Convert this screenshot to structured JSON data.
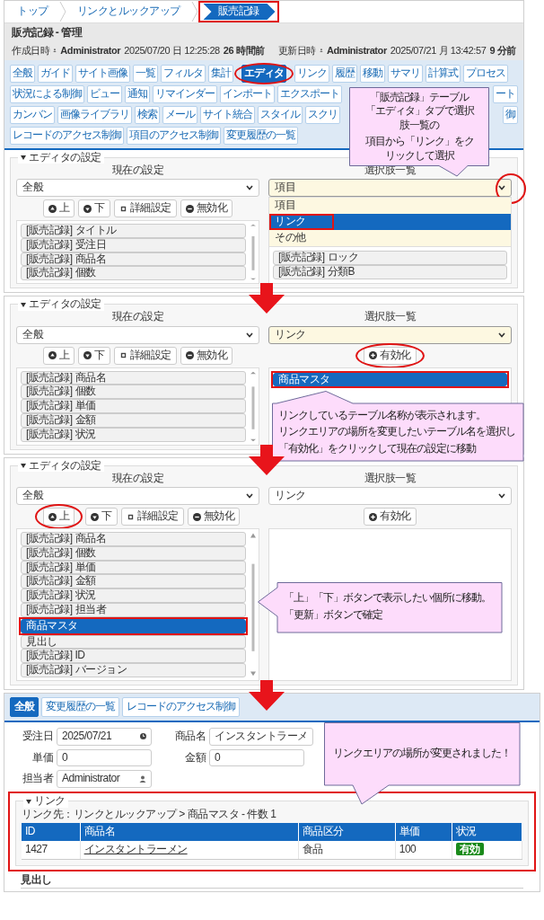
{
  "breadcrumb": [
    {
      "label": "トップ",
      "selected": false,
      "boxed": false
    },
    {
      "label": "リンクとルックアップ",
      "selected": false,
      "boxed": false
    },
    {
      "label": "販売記録",
      "selected": true,
      "boxed": true
    }
  ],
  "title": "販売記録 - 管理",
  "meta": {
    "created_label": "作成日時",
    "created_by": "Administrator",
    "created_at": "2025/07/20 日 12:25:28",
    "created_ago": "26 時間前",
    "updated_label": "更新日時",
    "updated_by": "Administrator",
    "updated_at": "2025/07/21 月 13:42:57",
    "updated_ago": "9 分前"
  },
  "tab_rows": [
    [
      {
        "label": "全般",
        "selected": false,
        "circled": false,
        "kind": "normal"
      },
      {
        "label": "ガイド",
        "selected": false,
        "circled": false,
        "kind": "normal"
      },
      {
        "label": "サイト画像",
        "selected": false,
        "circled": false,
        "kind": "normal"
      },
      {
        "label": "一覧",
        "selected": false,
        "circled": false,
        "kind": "normal"
      },
      {
        "label": "フィルタ",
        "selected": false,
        "circled": false,
        "kind": "normal"
      },
      {
        "label": "集計",
        "selected": false,
        "circled": false,
        "kind": "normal"
      },
      {
        "label": "エディタ",
        "selected": true,
        "circled": true,
        "kind": "normal"
      },
      {
        "label": "リンク",
        "selected": false,
        "circled": false,
        "kind": "normal"
      },
      {
        "label": "履歴",
        "selected": false,
        "circled": false,
        "kind": "normal"
      },
      {
        "label": "移動",
        "selected": false,
        "circled": false,
        "kind": "normal"
      },
      {
        "label": "サマリ",
        "selected": false,
        "circled": false,
        "kind": "normal"
      },
      {
        "label": "計算式",
        "selected": false,
        "circled": false,
        "kind": "normal"
      },
      {
        "label": "プロセス",
        "selected": false,
        "circled": false,
        "kind": "normal"
      }
    ],
    [
      {
        "label": "状況による制御",
        "selected": false,
        "circled": false,
        "kind": "normal"
      },
      {
        "label": "ビュー",
        "selected": false,
        "circled": false,
        "kind": "normal"
      },
      {
        "label": "通知",
        "selected": false,
        "circled": false,
        "kind": "normal"
      },
      {
        "label": "リマインダー",
        "selected": false,
        "circled": false,
        "kind": "normal"
      },
      {
        "label": "インポート",
        "selected": false,
        "circled": false,
        "kind": "normal"
      },
      {
        "label": "エクスポート",
        "selected": false,
        "circled": false,
        "kind": "normal"
      },
      {
        "label": "ート",
        "selected": false,
        "circled": false,
        "kind": "tail"
      }
    ],
    [
      {
        "label": "カンバン",
        "selected": false,
        "circled": false,
        "kind": "normal"
      },
      {
        "label": "画像ライブラリ",
        "selected": false,
        "circled": false,
        "kind": "normal"
      },
      {
        "label": "検索",
        "selected": false,
        "circled": false,
        "kind": "normal"
      },
      {
        "label": "メール",
        "selected": false,
        "circled": false,
        "kind": "normal"
      },
      {
        "label": "サイト統合",
        "selected": false,
        "circled": false,
        "kind": "normal"
      },
      {
        "label": "スタイル",
        "selected": false,
        "circled": false,
        "kind": "normal"
      },
      {
        "label": "スクリ",
        "selected": false,
        "circled": false,
        "kind": "normal"
      },
      {
        "label": "御",
        "selected": false,
        "circled": false,
        "kind": "tail"
      }
    ],
    [
      {
        "label": "レコードのアクセス制御",
        "selected": false,
        "circled": false,
        "kind": "normal"
      },
      {
        "label": "項目のアクセス制御",
        "selected": false,
        "circled": false,
        "kind": "normal"
      },
      {
        "label": "変更履歴の一覧",
        "selected": false,
        "circled": false,
        "kind": "normal"
      }
    ]
  ],
  "steps": [
    {
      "callout": [
        "「販売記録」テーブル「エディタ」タブで選択肢一覧の",
        "項目から「リンク」をクリックして選択"
      ],
      "editor": {
        "legend": "エディタの設定",
        "current": {
          "heading": "現在の設定",
          "select": {
            "value": "全般",
            "focused": false,
            "circled": false
          },
          "buttons": [
            {
              "kind": "up",
              "label": "上",
              "circled": false
            },
            {
              "kind": "down",
              "label": "下",
              "circled": false
            },
            {
              "kind": "detail",
              "label": "詳細設定",
              "circled": false
            },
            {
              "kind": "disable",
              "label": "無効化",
              "circled": false
            }
          ],
          "items": [
            {
              "label": "[販売記録] タイトル",
              "selected": false,
              "boxed": false
            },
            {
              "label": "[販売記録] 受注日",
              "selected": false,
              "boxed": false
            },
            {
              "label": "[販売記録] 商品名",
              "selected": false,
              "boxed": false
            },
            {
              "label": "[販売記録] 個数",
              "selected": false,
              "boxed": false
            }
          ]
        },
        "options": {
          "heading": "選択肢一覧",
          "select": {
            "value": "項目",
            "focused": true,
            "circled": true
          },
          "dropdown": [
            {
              "label": "項目",
              "selected": false,
              "boxed": false
            },
            {
              "label": "リンク",
              "selected": true,
              "boxed": true
            },
            {
              "label": "その他",
              "selected": false,
              "boxed": false
            }
          ],
          "items": [
            {
              "label": "[販売記録] ロック",
              "selected": false,
              "boxed": false
            },
            {
              "label": "[販売記録] 分類B",
              "selected": false,
              "boxed": false
            }
          ]
        }
      }
    },
    {
      "callout": [
        "リンクしているテーブル名称が表示されます。",
        "リンクエリアの場所を変更したいテーブル名を選択し",
        "「有効化」をクリックして現在の設定に移動"
      ],
      "editor": {
        "legend": "エディタの設定",
        "current": {
          "heading": "現在の設定",
          "select": {
            "value": "全般",
            "focused": false,
            "circled": false
          },
          "buttons": [
            {
              "kind": "up",
              "label": "上",
              "circled": false
            },
            {
              "kind": "down",
              "label": "下",
              "circled": false
            },
            {
              "kind": "detail",
              "label": "詳細設定",
              "circled": false
            },
            {
              "kind": "disable",
              "label": "無効化",
              "circled": false
            }
          ],
          "items": [
            {
              "label": "[販売記録] 商品名",
              "selected": false,
              "boxed": false
            },
            {
              "label": "[販売記録] 個数",
              "selected": false,
              "boxed": false
            },
            {
              "label": "[販売記録] 単価",
              "selected": false,
              "boxed": false
            },
            {
              "label": "[販売記録] 金額",
              "selected": false,
              "boxed": false
            },
            {
              "label": "[販売記録] 状況",
              "selected": false,
              "boxed": false
            }
          ]
        },
        "options": {
          "heading": "選択肢一覧",
          "select": {
            "value": "リンク",
            "focused": true,
            "circled": false
          },
          "buttons": [
            {
              "kind": "enable",
              "label": "有効化",
              "circled": true
            }
          ],
          "items": [
            {
              "label": "商品マスタ",
              "selected": true,
              "boxed": true
            }
          ]
        }
      }
    },
    {
      "callout": [
        "「上」「下」ボタンで表示したい個所に移動。",
        "「更新」ボタンで確定"
      ],
      "editor": {
        "legend": "エディタの設定",
        "current": {
          "heading": "現在の設定",
          "select": {
            "value": "全般",
            "focused": false,
            "circled": false
          },
          "buttons": [
            {
              "kind": "up",
              "label": "上",
              "circled": true
            },
            {
              "kind": "down",
              "label": "下",
              "circled": false
            },
            {
              "kind": "detail",
              "label": "詳細設定",
              "circled": false
            },
            {
              "kind": "disable",
              "label": "無効化",
              "circled": false
            }
          ],
          "items": [
            {
              "label": "[販売記録] 商品名",
              "selected": false,
              "boxed": false
            },
            {
              "label": "[販売記録] 個数",
              "selected": false,
              "boxed": false
            },
            {
              "label": "[販売記録] 単価",
              "selected": false,
              "boxed": false
            },
            {
              "label": "[販売記録] 金額",
              "selected": false,
              "boxed": false
            },
            {
              "label": "[販売記録] 状況",
              "selected": false,
              "boxed": false
            },
            {
              "label": "[販売記録] 担当者",
              "selected": false,
              "boxed": false
            },
            {
              "label": "商品マスタ",
              "selected": true,
              "boxed": true
            },
            {
              "label": "見出し",
              "selected": false,
              "boxed": false
            },
            {
              "label": "[販売記録] ID",
              "selected": false,
              "boxed": false
            },
            {
              "label": "[販売記録] バージョン",
              "selected": false,
              "boxed": false
            }
          ]
        },
        "options": {
          "heading": "選択肢一覧",
          "select": {
            "value": "リンク",
            "focused": false,
            "circled": false
          },
          "buttons": [
            {
              "kind": "enable",
              "label": "有効化",
              "circled": false
            }
          ]
        }
      }
    }
  ],
  "record": {
    "tabs": [
      {
        "label": "全般",
        "selected": true
      },
      {
        "label": "変更履歴の一覧",
        "selected": false
      },
      {
        "label": "レコードのアクセス制御",
        "selected": false
      }
    ],
    "fields": [
      {
        "label": "受注日",
        "value": "2025/07/21",
        "kind": "date"
      },
      {
        "label": "商品名",
        "value": "インスタントラーメ",
        "kind": "text"
      },
      {
        "label": "単価",
        "value": "0",
        "kind": "text"
      },
      {
        "label": "金額",
        "value": "0",
        "kind": "text"
      },
      {
        "label": "担当者",
        "value": "Administrator",
        "kind": "user"
      }
    ],
    "callout": [
      "リンクエリアの場所が変更されました！"
    ],
    "link_section": {
      "legend": "リンク",
      "boxed": true,
      "caption": "リンク先：リンクとルックアップ > 商品マスタ - 件数 1",
      "columns": [
        "ID",
        "商品名",
        "商品区分",
        "単価",
        "状況"
      ],
      "rows": [
        {
          "id": "1427",
          "name": "インスタントラーメン",
          "category": "食品",
          "price": "100",
          "status": "有効"
        }
      ]
    },
    "heading": "見出し"
  }
}
